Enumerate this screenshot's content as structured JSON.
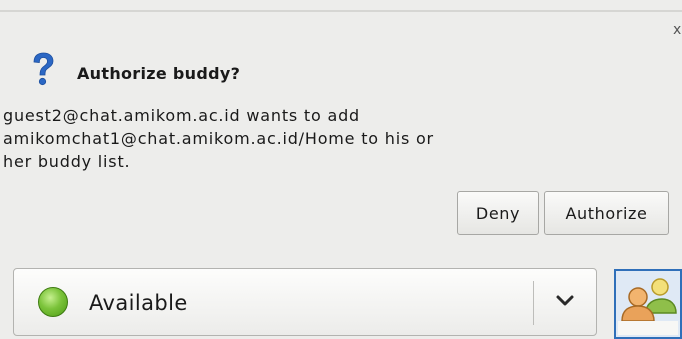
{
  "notification": {
    "title": "Authorize buddy?",
    "message": "guest2@chat.amikom.ac.id wants to add\namikomchat1@chat.amikom.ac.id/Home to his or\nher buddy list.",
    "close_glyph": "x",
    "icon": "question-icon",
    "buttons": {
      "deny": "Deny",
      "authorize": "Authorize"
    }
  },
  "status": {
    "label": "Available",
    "icon": "available-status-icon",
    "color": "#6cb52f"
  },
  "avatar": {
    "icon": "buddy-avatar-icon"
  }
}
